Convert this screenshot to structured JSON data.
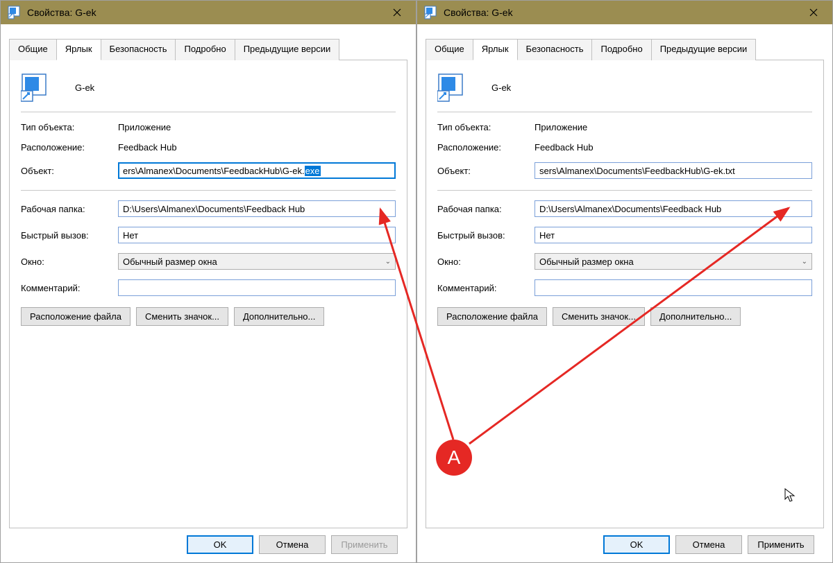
{
  "left": {
    "title": "Свойства: G-ek",
    "tabs": [
      "Общие",
      "Ярлык",
      "Безопасность",
      "Подробно",
      "Предыдущие версии"
    ],
    "active_tab": 1,
    "app_name": "G-ek",
    "type_label": "Тип объекта:",
    "type_value": "Приложение",
    "location_label": "Расположение:",
    "location_value": "Feedback Hub",
    "target_label": "Объект:",
    "target_value_prefix": "ers\\Almanex\\Documents\\FeedbackHub\\G-ek.",
    "target_value_ext": "exe",
    "workdir_label": "Рабочая папка:",
    "workdir_value": "D:\\Users\\Almanex\\Documents\\Feedback Hub",
    "shortcut_label": "Быстрый вызов:",
    "shortcut_value": "Нет",
    "window_label": "Окно:",
    "window_value": "Обычный размер окна",
    "comment_label": "Комментарий:",
    "comment_value": "",
    "btn_openloc": "Расположение файла",
    "btn_changeicon": "Сменить значок...",
    "btn_advanced": "Дополнительно...",
    "btn_ok": "OK",
    "btn_cancel": "Отмена",
    "btn_apply": "Применить"
  },
  "right": {
    "title": "Свойства: G-ek",
    "tabs": [
      "Общие",
      "Ярлык",
      "Безопасность",
      "Подробно",
      "Предыдущие версии"
    ],
    "active_tab": 1,
    "app_name": "G-ek",
    "type_label": "Тип объекта:",
    "type_value": "Приложение",
    "location_label": "Расположение:",
    "location_value": "Feedback Hub",
    "target_label": "Объект:",
    "target_value": "sers\\Almanex\\Documents\\FeedbackHub\\G-ek.txt",
    "workdir_label": "Рабочая папка:",
    "workdir_value": "D:\\Users\\Almanex\\Documents\\Feedback Hub",
    "shortcut_label": "Быстрый вызов:",
    "shortcut_value": "Нет",
    "window_label": "Окно:",
    "window_value": "Обычный размер окна",
    "comment_label": "Комментарий:",
    "comment_value": "",
    "btn_openloc": "Расположение файла",
    "btn_changeicon": "Сменить значок...",
    "btn_advanced": "Дополнительно...",
    "btn_ok": "OK",
    "btn_cancel": "Отмена",
    "btn_apply": "Применить"
  },
  "annotation": {
    "badge": "A"
  }
}
